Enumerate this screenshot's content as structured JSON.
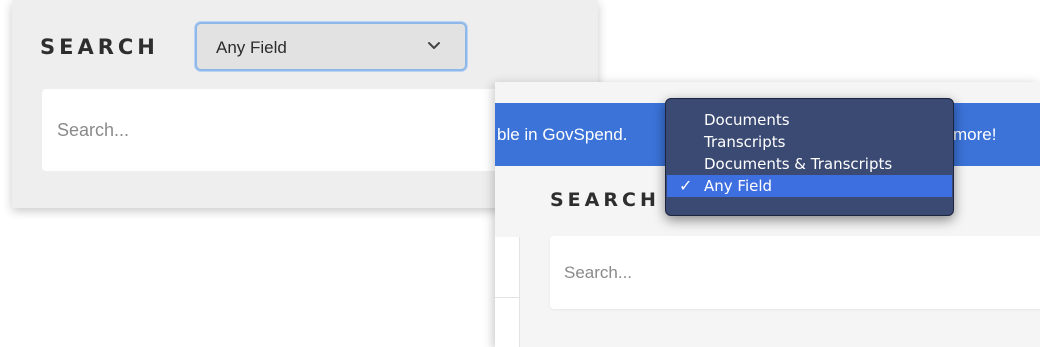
{
  "panel_left": {
    "search_label": "SEARCH",
    "select_value": "Any Field",
    "search_placeholder": "Search..."
  },
  "panel_right": {
    "banner_left_text": "ble in GovSpend.",
    "banner_right_text": "more!",
    "search_label": "SEARCH",
    "search_placeholder": "Search..."
  },
  "dropdown": {
    "options": [
      {
        "label": "Documents",
        "selected": false
      },
      {
        "label": "Transcripts",
        "selected": false
      },
      {
        "label": "Documents & Transcripts",
        "selected": false
      },
      {
        "label": "Any Field",
        "selected": true
      }
    ],
    "check_glyph": "✓"
  },
  "colors": {
    "banner": "#3b73d9",
    "menu_bg": "#3a4a73",
    "menu_selected": "#3e6fe0",
    "select_focus_border": "#8fb8ea"
  },
  "icons": {
    "select_chevron": "chevron-down-icon",
    "selected_option": "checkmark-icon"
  }
}
